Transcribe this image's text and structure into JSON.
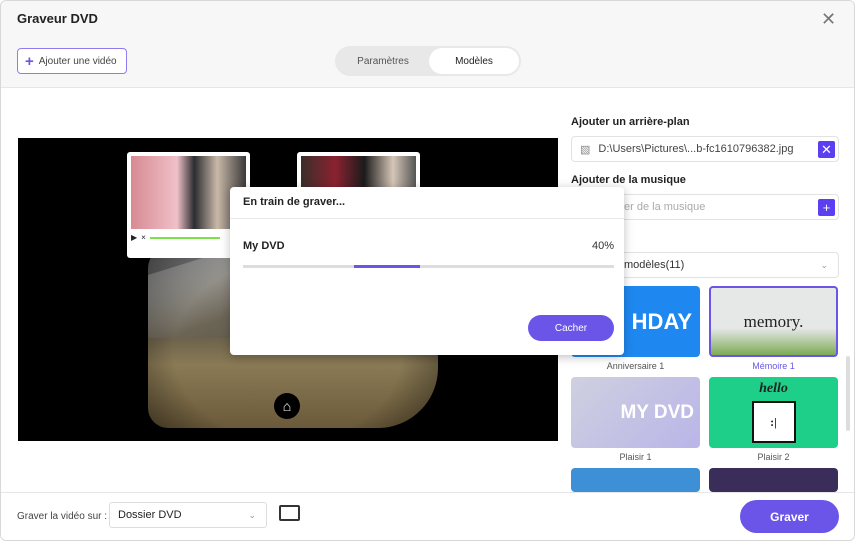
{
  "window": {
    "title": "Graveur DVD"
  },
  "toolbar": {
    "add_video": "Ajouter une vidéo",
    "tabs": [
      {
        "label": "Paramètres",
        "active": false
      },
      {
        "label": "Modèles",
        "active": true
      }
    ]
  },
  "dialog": {
    "title": "En train de graver...",
    "item": "My DVD",
    "progress_label": "40%",
    "progress": 40,
    "hide_button": "Cacher"
  },
  "right": {
    "background_label": "Ajouter un arrière-plan",
    "background_value": "D:\\Users\\Pictures\\...b-fc1610796382.jpg",
    "music_label": "Ajouter de la musique",
    "music_placeholder": "er de la musique",
    "templates_dropdown": "modèles(11)",
    "templates": [
      {
        "label": "Anniversaire 1",
        "text": "HDAY",
        "selected": false
      },
      {
        "label": "Mémoire 1",
        "text": "memory.",
        "selected": true
      },
      {
        "label": "Plaisir 1",
        "text": "MY DVD",
        "selected": false
      },
      {
        "label": "Plaisir 2",
        "text": "hello",
        "selected": false
      }
    ]
  },
  "bottom": {
    "burn_to_label": "Graver la vidéo sur :",
    "burn_to_value": "Dossier DVD",
    "burn_button": "Graver"
  },
  "colors": {
    "accent": "#6a55e8"
  }
}
